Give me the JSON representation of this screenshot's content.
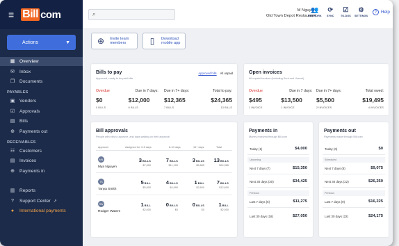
{
  "brand": {
    "logo_b": "Bill",
    "logo_rest": "com"
  },
  "sidebar": {
    "actions_label": "Actions",
    "top_items": [
      {
        "label": "Overview",
        "icon": "overview-icon"
      },
      {
        "label": "Inbox",
        "icon": "inbox-icon"
      },
      {
        "label": "Documents",
        "icon": "documents-icon"
      }
    ],
    "payables_head": "PAYABLES",
    "payables": [
      {
        "label": "Vendors"
      },
      {
        "label": "Approvals"
      },
      {
        "label": "Bills"
      },
      {
        "label": "Payments out"
      }
    ],
    "receivables_head": "RECEIVABLES",
    "receivables": [
      {
        "label": "Customers"
      },
      {
        "label": "Invoices"
      },
      {
        "label": "Payments in"
      }
    ],
    "bottom": [
      {
        "label": "Reports"
      },
      {
        "label": "Support Center"
      },
      {
        "label": "International payments"
      }
    ]
  },
  "topbar": {
    "user_name": "M Nguyen",
    "org_name": "Old Town Depot Restaurant",
    "nav": [
      {
        "label": "NETWORK",
        "icon": "network-icon"
      },
      {
        "label": "SYNC",
        "icon": "sync-icon"
      },
      {
        "label": "TO-DOS",
        "icon": "todos-icon"
      },
      {
        "label": "SETTINGS",
        "icon": "gear-icon"
      }
    ],
    "help": "Help"
  },
  "quick": {
    "invite": [
      "Invite team",
      "members"
    ],
    "download": [
      "Download",
      "mobile app"
    ]
  },
  "bills_to_pay": {
    "title": "Bills to pay",
    "subtitle": "Approved, ready to be paid bills",
    "tab_on": "Approved bills",
    "tab_off": "All unpaid",
    "stats": [
      {
        "label": "Overdue",
        "value": "$0",
        "sub": "0 BILLS"
      },
      {
        "label": "Due in 7 days:",
        "value": "$12,000",
        "sub": "6 BILLS"
      },
      {
        "label": "Due in 7+ days:",
        "value": "$12,365",
        "sub": "7 BILLS"
      },
      {
        "label": "Total to pay:",
        "value": "$24,365",
        "sub": "13 BILLS"
      }
    ]
  },
  "open_invoices": {
    "title": "Open invoices",
    "subtitle": "All unpaid invoices (including Sent and Unsent)",
    "stats": [
      {
        "label": "Overdue",
        "value": "$495",
        "sub": "1 INVOICE"
      },
      {
        "label": "Due in 7 days:",
        "value": "$13,500",
        "sub": "1 INVOICE"
      },
      {
        "label": "Due in 7+ days:",
        "value": "$5,500",
        "sub": "2 INVOICES"
      },
      {
        "label": "Total owed:",
        "value": "$19,495",
        "sub": "4 INVOICES"
      }
    ]
  },
  "approvals": {
    "title": "Bill approvals",
    "subtitle": "People with bills to approve, and days waiting on their approval",
    "headers": [
      "Approver",
      "Assigned for: 0-5 days",
      "6-10 days",
      "10+ days",
      "Total"
    ],
    "rows": [
      {
        "initials": "MN",
        "name": "Mya Nguyen",
        "c": [
          {
            "n": "3",
            "u": "BILLS",
            "a": "$7,000"
          },
          {
            "n": "7",
            "u": "BILLS",
            "a": "$11,100"
          },
          {
            "n": "3",
            "u": "BILLS",
            "a": "$5,865"
          },
          {
            "n": "13",
            "u": "BILLS",
            "a": "$24,365"
          }
        ]
      },
      {
        "initials": "TS",
        "name": "Tanya Smith",
        "c": [
          {
            "n": "5",
            "u": "BILL",
            "a": "$5,000"
          },
          {
            "n": "4",
            "u": "BILLS",
            "a": "$4,990"
          },
          {
            "n": "1",
            "u": "BILL",
            "a": "$2,600"
          },
          {
            "n": "7",
            "u": "BILLS",
            "a": "$12,600"
          }
        ]
      },
      {
        "initials": "RW",
        "name": "Rodger Waters",
        "c": [
          {
            "n": "1",
            "u": "BILL",
            "a": "$2,000"
          },
          {
            "n": "0",
            "u": "BILLS",
            "a": "$0"
          },
          {
            "n": "0",
            "u": "BILLS",
            "a": "$0"
          },
          {
            "n": "1",
            "u": "BILL",
            "a": "$2,000"
          }
        ]
      }
    ]
  },
  "payments_in": {
    "title": "Payments in",
    "subtitle": "Money received through Bill.com",
    "today": {
      "label": "Today (1)",
      "value": "$4,000"
    },
    "upcoming_head": "Upcoming",
    "upcoming": [
      {
        "label": "Next 7 days (7)",
        "value": "$15,350"
      },
      {
        "label": "Next 30 days (30)",
        "value": "$34,425"
      }
    ],
    "previous_head": "Previous",
    "previous": [
      {
        "label": "Last 7 days (5)",
        "value": "$11,275"
      },
      {
        "label": "Last 30 days (18)",
        "value": "$27,050"
      }
    ]
  },
  "payments_out": {
    "title": "Payments out",
    "subtitle": "Payments made through Bill.com",
    "today": {
      "label": "Today (0)",
      "value": "$0"
    },
    "upcoming_head": "Scheduled",
    "upcoming": [
      {
        "label": "Next 7 days (8)",
        "value": "$9,075"
      },
      {
        "label": "Next 30 days (22)",
        "value": "$26,250"
      }
    ],
    "previous_head": "Previous",
    "previous": [
      {
        "label": "Last 7 days (9)",
        "value": "$16,225"
      },
      {
        "label": "Last 30 days (22)",
        "value": "$24,175"
      }
    ]
  }
}
